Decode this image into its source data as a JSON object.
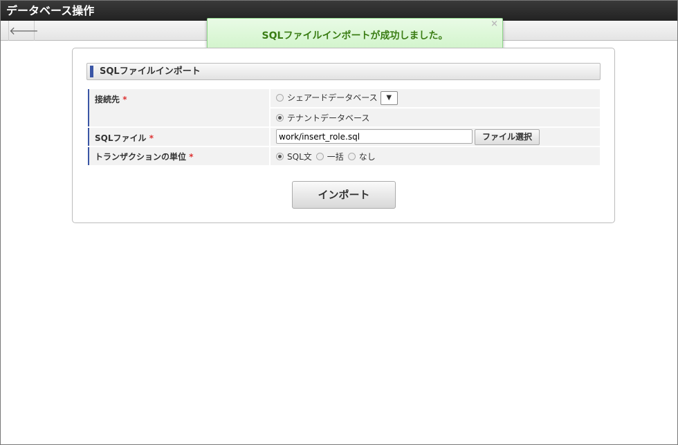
{
  "window": {
    "title": "データベース操作"
  },
  "toolbar": {
    "back_icon": "arrow-left-icon"
  },
  "toast": {
    "message": "SQLファイルインポートが成功しました。",
    "close": "×"
  },
  "section": {
    "title": "SQLファイルインポート"
  },
  "form": {
    "connection": {
      "label": "接続先",
      "required": "*",
      "options": [
        "シェアードデータベース",
        "テナントデータベース"
      ],
      "selected": 1,
      "dropdown": "▼"
    },
    "sqlfile": {
      "label": "SQLファイル",
      "required": "*",
      "value": "work/insert_role.sql",
      "button": "ファイル選択"
    },
    "transaction": {
      "label": "トランザクションの単位",
      "required": "*",
      "options": [
        "SQL文",
        "一括",
        "なし"
      ],
      "selected": 0
    }
  },
  "actions": {
    "import": "インポート"
  }
}
